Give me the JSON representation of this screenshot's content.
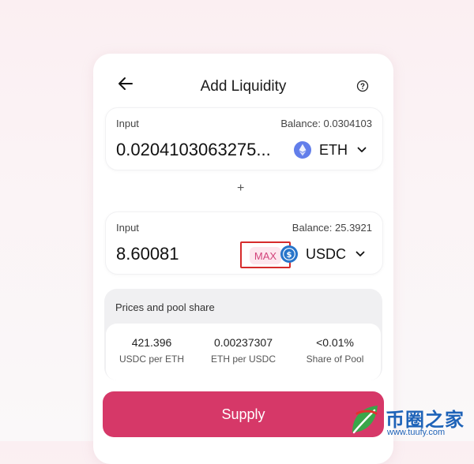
{
  "header": {
    "title": "Add Liquidity",
    "back_icon": "arrow-left-icon",
    "help_icon": "question-circle-icon"
  },
  "input_a": {
    "label": "Input",
    "balance": "Balance: 0.0304103",
    "value": "0.0204103063275...",
    "token": "ETH",
    "token_icon": "eth-icon"
  },
  "plus": "+",
  "input_b": {
    "label": "Input",
    "balance": "Balance: 25.3921",
    "value": "8.60081",
    "max_label": "MAX",
    "token": "USDC",
    "token_icon": "usdc-icon"
  },
  "share": {
    "title": "Prices and pool share",
    "stats": [
      {
        "value": "421.396",
        "label": "USDC per ETH"
      },
      {
        "value": "0.00237307",
        "label": "ETH per USDC"
      },
      {
        "value": "<0.01%",
        "label": "Share of Pool"
      }
    ]
  },
  "supply_label": "Supply",
  "watermark": {
    "name": "币圈之家",
    "url": "www.tuufy.com"
  },
  "colors": {
    "accent": "#d63868",
    "max_bg": "#fde6ee",
    "max_text": "#d2437b",
    "highlight_border": "#d62b2b",
    "eth_icon": "#627eea",
    "usdc_icon": "#2775ca"
  }
}
